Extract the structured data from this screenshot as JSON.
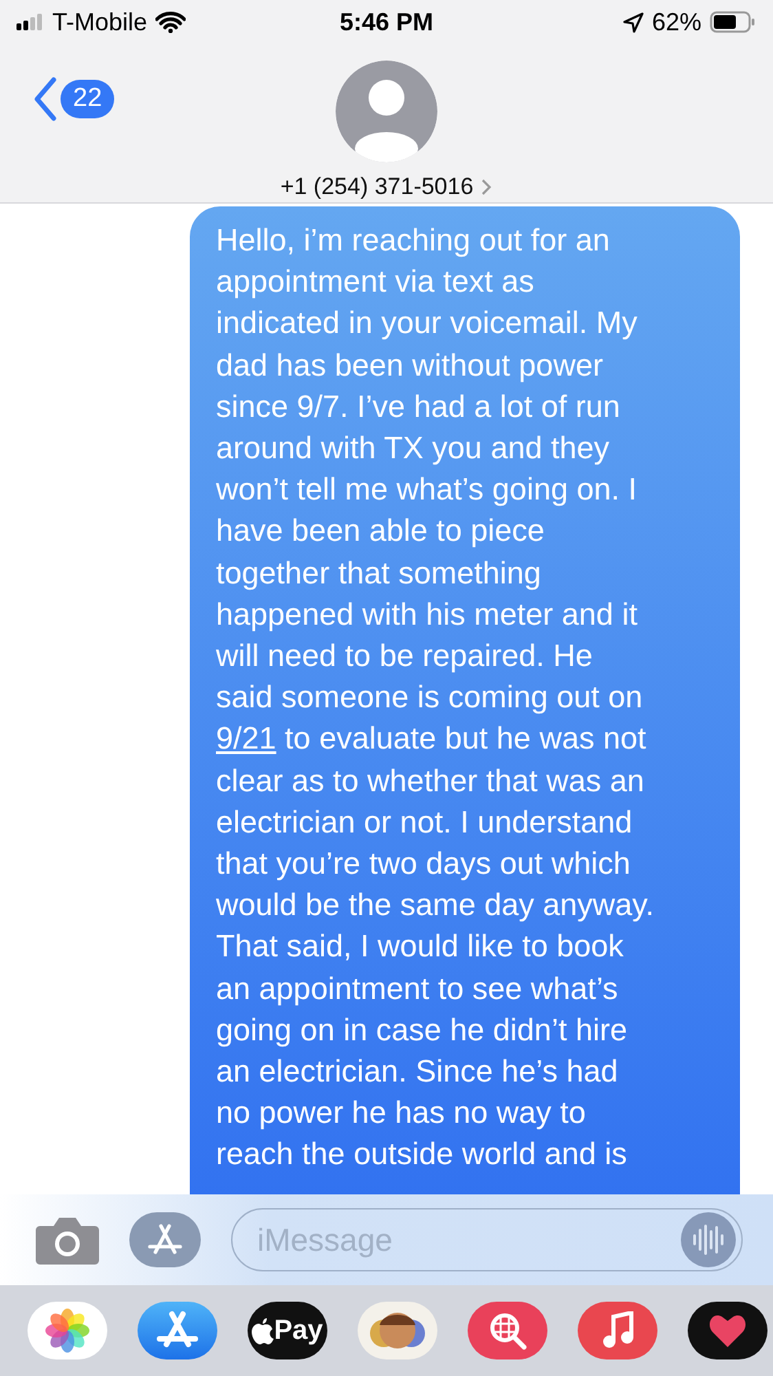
{
  "status_bar": {
    "carrier": "T-Mobile",
    "time": "5:46 PM",
    "battery": "62%"
  },
  "header": {
    "unread_count": "22",
    "contact": "+1 (254) 371-5016"
  },
  "message": {
    "lines": [
      {
        "kind": "text",
        "text": "Hello, i’m reaching out for an"
      },
      {
        "kind": "text",
        "text": "appointment via text as"
      },
      {
        "kind": "text",
        "text": "indicated in your voicemail. My"
      },
      {
        "kind": "text",
        "text": "dad has been without power"
      },
      {
        "kind": "text",
        "text": "since 9/7. I’ve had a lot of run"
      },
      {
        "kind": "text",
        "text": "around with TX you and they"
      },
      {
        "kind": "text",
        "text": "won’t tell me what’s going on. I"
      },
      {
        "kind": "text",
        "text": "have been able to piece"
      },
      {
        "kind": "text",
        "text": "together that something"
      },
      {
        "kind": "text",
        "text": "happened with his meter and it"
      },
      {
        "kind": "text",
        "text": "will need to be repaired. He"
      },
      {
        "kind": "text",
        "text": "said someone is coming out on"
      },
      {
        "kind": "link",
        "link": "9/21",
        "text": " to evaluate but he was not"
      },
      {
        "kind": "text",
        "text": "clear as to whether that was an"
      },
      {
        "kind": "text",
        "text": "electrician or not. I understand"
      },
      {
        "kind": "text",
        "text": "that you’re two days out which"
      },
      {
        "kind": "text",
        "text": "would be the same day anyway."
      },
      {
        "kind": "text",
        "text": "That said, I would like to book"
      },
      {
        "kind": "text",
        "text": "an appointment to see what’s"
      },
      {
        "kind": "text",
        "text": "going on in case he didn’t hire"
      },
      {
        "kind": "text",
        "text": "an electrician. Since he’s had"
      },
      {
        "kind": "text",
        "text": "no power he has no way to"
      },
      {
        "kind": "text",
        "text": "reach the outside world and is"
      }
    ]
  },
  "composer": {
    "placeholder": "iMessage"
  },
  "app_drawer": [
    {
      "kind": "photos"
    },
    {
      "kind": "appstore"
    },
    {
      "kind": "applepay",
      "label": "Pay"
    },
    {
      "kind": "memoji"
    },
    {
      "kind": "images"
    },
    {
      "kind": "music"
    },
    {
      "kind": "touch"
    }
  ]
}
